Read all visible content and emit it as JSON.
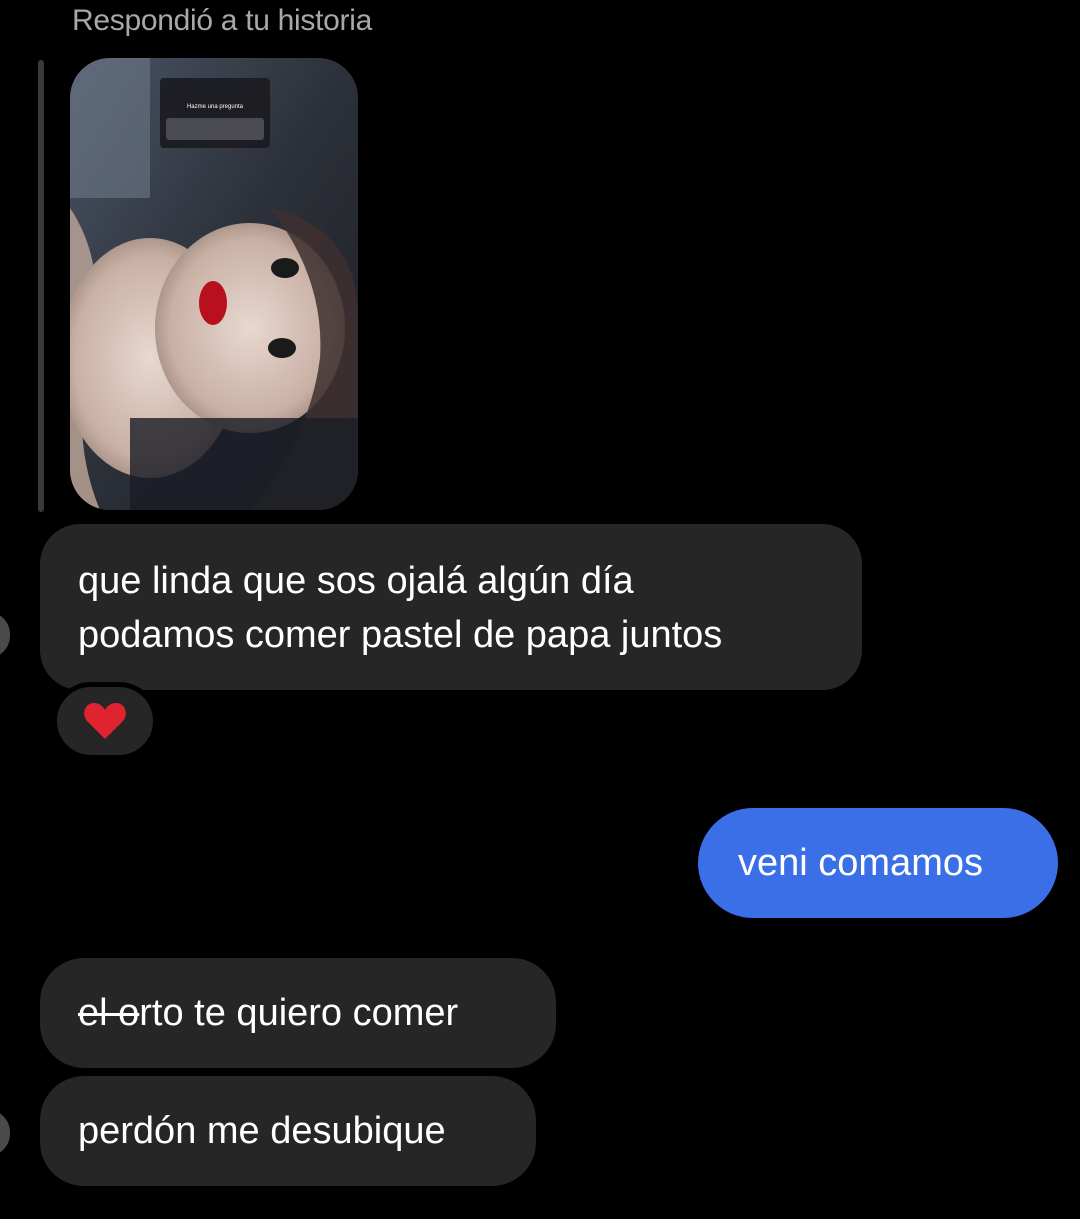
{
  "header": {
    "reply_label": "Respondió a tu historia"
  },
  "story_reply": {
    "icon": "story-thumbnail",
    "overlay_text": "Hazme una pregunta"
  },
  "messages": [
    {
      "from": "them",
      "lines": [
        "que linda que sos ojalá algún día",
        "podamos comer pastel de papa juntos"
      ],
      "reaction": "heart"
    },
    {
      "from": "me",
      "text": "veni comamos"
    },
    {
      "from": "them",
      "struck": "el o",
      "text": "rto te quiero comer"
    },
    {
      "from": "them",
      "text": "perdón me desubique"
    }
  ],
  "colors": {
    "background": "#000000",
    "incoming_bubble": "#262626",
    "outgoing_bubble": "#3a6fe8",
    "reaction_heart": "#e0242f",
    "muted_text": "#a8a8a8"
  }
}
